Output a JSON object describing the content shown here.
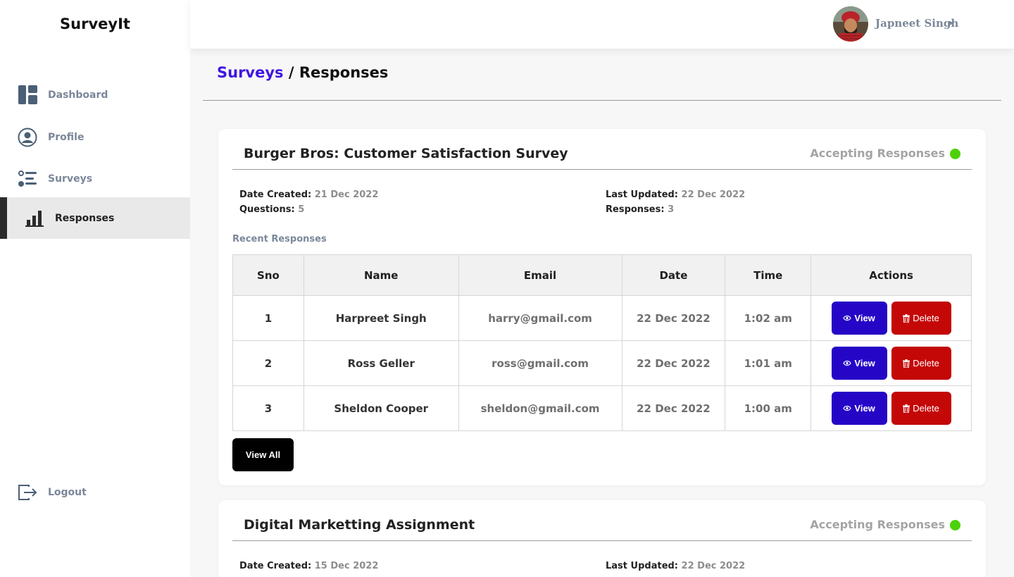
{
  "app": {
    "brand": "SurveyIt"
  },
  "sidebar": {
    "items": [
      {
        "label": "Dashboard",
        "icon": "dashboard-icon"
      },
      {
        "label": "Profile",
        "icon": "user-circle-icon"
      },
      {
        "label": "Surveys",
        "icon": "list-icon"
      },
      {
        "label": "Responses",
        "icon": "bar-chart-icon",
        "active": true
      }
    ],
    "logout": {
      "label": "Logout",
      "icon": "logout-icon"
    }
  },
  "topbar": {
    "user_name": "Japneet Singh"
  },
  "breadcrumb": {
    "parent": "Surveys",
    "separator": "/",
    "current": "Responses"
  },
  "colors": {
    "accent": "#3e16e0",
    "view": "#2506c7",
    "delete": "#c40707",
    "status_dot": "#4cd109"
  },
  "surveys": [
    {
      "title": "Burger Bros: Customer Satisfaction Survey",
      "status": "Accepting Responses",
      "date_created_label": "Date Created:",
      "date_created": "21 Dec 2022",
      "last_updated_label": "Last Updated:",
      "last_updated": "22 Dec 2022",
      "questions_label": "Questions:",
      "questions": "5",
      "responses_label": "Responses:",
      "responses": "3",
      "recent_label": "Recent Responses",
      "columns": [
        "Sno",
        "Name",
        "Email",
        "Date",
        "Time",
        "Actions"
      ],
      "rows": [
        {
          "sno": "1",
          "name": "Harpreet Singh",
          "email": "harry@gmail.com",
          "date": "22 Dec 2022",
          "time": "1:02 am"
        },
        {
          "sno": "2",
          "name": "Ross Geller",
          "email": "ross@gmail.com",
          "date": "22 Dec 2022",
          "time": "1:01 am"
        },
        {
          "sno": "3",
          "name": "Sheldon Cooper",
          "email": "sheldon@gmail.com",
          "date": "22 Dec 2022",
          "time": "1:00 am"
        }
      ],
      "view_label": "View",
      "delete_label": "Delete",
      "view_all_label": "View All"
    },
    {
      "title": "Digital Marketting Assignment",
      "status": "Accepting Responses",
      "date_created_label": "Date Created:",
      "date_created": "15 Dec 2022",
      "last_updated_label": "Last Updated:",
      "last_updated": "22 Dec 2022"
    }
  ]
}
